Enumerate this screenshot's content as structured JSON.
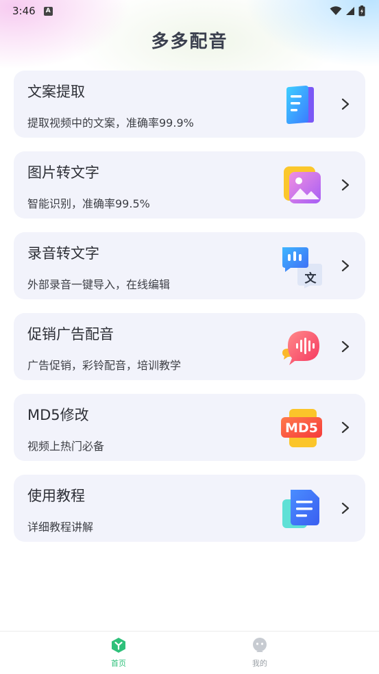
{
  "status_bar": {
    "time": "3:46",
    "notification_badge": "A"
  },
  "header": {
    "title": "多多配音"
  },
  "cards": [
    {
      "title": "文案提取",
      "desc": "提取视频中的文案，准确率99.9%",
      "icon": "document-icon"
    },
    {
      "title": "图片转文字",
      "desc": "智能识别，准确率99.5%",
      "icon": "image-icon"
    },
    {
      "title": "录音转文字",
      "desc": "外部录音一键导入，在线编辑",
      "icon": "speech-translate-icon"
    },
    {
      "title": "促销广告配音",
      "desc": "广告促销，彩铃配音，培训教学",
      "icon": "voice-bubble-icon"
    },
    {
      "title": "MD5修改",
      "desc": "视频上热门必备",
      "icon": "md5-icon",
      "icon_text": "MD5"
    },
    {
      "title": "使用教程",
      "desc": "详细教程讲解",
      "icon": "tutorial-icon"
    }
  ],
  "bottom_nav": [
    {
      "label": "首页",
      "icon": "home-icon",
      "active": true
    },
    {
      "label": "我的",
      "icon": "profile-icon",
      "active": false
    }
  ],
  "colors": {
    "accent": "#2ec07a",
    "card_bg": "#f2f3fb",
    "title": "#3a3f4e"
  }
}
